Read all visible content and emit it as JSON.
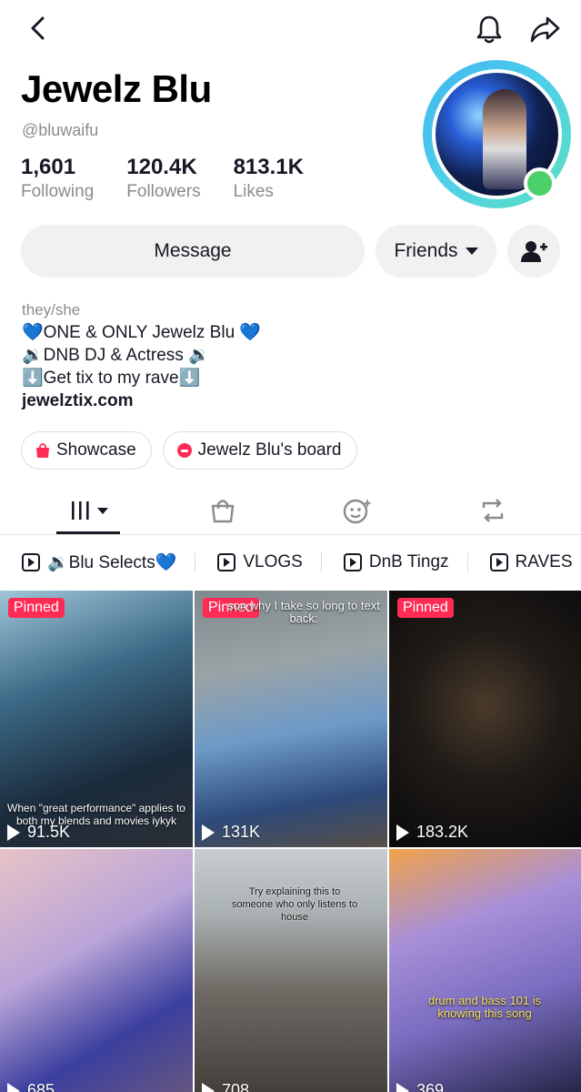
{
  "profile": {
    "name": "Jewelz Blu",
    "handle": "@bluwaifu",
    "stats": [
      {
        "value": "1,601",
        "label": "Following"
      },
      {
        "value": "120.4K",
        "label": "Followers"
      },
      {
        "value": "813.1K",
        "label": "Likes"
      }
    ],
    "online": true
  },
  "actions": {
    "message": "Message",
    "friends": "Friends"
  },
  "bio": {
    "pronouns": "they/she",
    "lines": [
      "💙ONE & ONLY Jewelz Blu 💙",
      "🔉DNB DJ & Actress 🔉",
      "⬇️Get tix to my rave⬇️"
    ],
    "link": "jewelztix.com"
  },
  "chips": [
    {
      "label": "Showcase",
      "icon": "shopping-bag-icon"
    },
    {
      "label": "Jewelz Blu's board",
      "icon": "board-icon"
    }
  ],
  "tabs": [
    {
      "name": "videos-grid-icon",
      "active": true
    },
    {
      "name": "shop-bag-icon",
      "active": false
    },
    {
      "name": "favorites-face-icon",
      "active": false
    },
    {
      "name": "repost-icon",
      "active": false
    }
  ],
  "playlists": [
    {
      "label": "🔉Blu Selects💙"
    },
    {
      "label": "VLOGS"
    },
    {
      "label": "DnB Tingz"
    },
    {
      "label": "RAVES"
    }
  ],
  "videos": [
    {
      "pinned": "Pinned",
      "views": "91.5K",
      "caption": "When \"great performance\" applies to both my blends and movies iykyk"
    },
    {
      "pinned": "Pinned",
      "views": "131K",
      "caption": "son why I take so long to text back:"
    },
    {
      "pinned": "Pinned",
      "views": "183.2K",
      "caption": ""
    },
    {
      "pinned": "",
      "views": "685",
      "caption": ""
    },
    {
      "pinned": "",
      "views": "708",
      "caption": "Try explaining this to someone who only listens to house"
    },
    {
      "pinned": "",
      "views": "369",
      "caption": "drum and bass 101 is knowing this song"
    }
  ],
  "colors": {
    "accent": "#fe2c55",
    "text": "#161823",
    "muted": "#8a8b91",
    "button_bg": "#f1f1f2",
    "online": "#4cd06a"
  }
}
